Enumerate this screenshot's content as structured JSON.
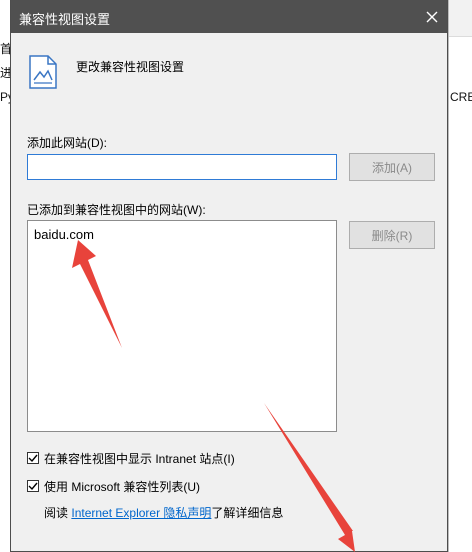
{
  "dialog": {
    "title": "兼容性视图设置",
    "header_text": "更改兼容性视图设置",
    "add_site_label": "添加此网站(D):",
    "add_site_value": "",
    "add_button": "添加(A)",
    "added_sites_label": "已添加到兼容性视图中的网站(W):",
    "sites": [
      "baidu.com"
    ],
    "remove_button": "删除(R)",
    "option_intranet": "在兼容性视图中显示 Intranet 站点(I)",
    "option_intranet_checked": true,
    "option_ms_list": "使用 Microsoft 兼容性列表(U)",
    "option_ms_list_checked": true,
    "footer_prefix": "阅读",
    "footer_link": "Internet Explorer 隐私声明",
    "footer_suffix": "了解详细信息"
  },
  "background": {
    "left_fragments": [
      "首",
      "进",
      "Py"
    ],
    "right_fragment": "CRE"
  },
  "colors": {
    "titlebar": "#505050",
    "input_border": "#2f7bd6",
    "link": "#0066cc",
    "arrow": "#e8433b"
  }
}
